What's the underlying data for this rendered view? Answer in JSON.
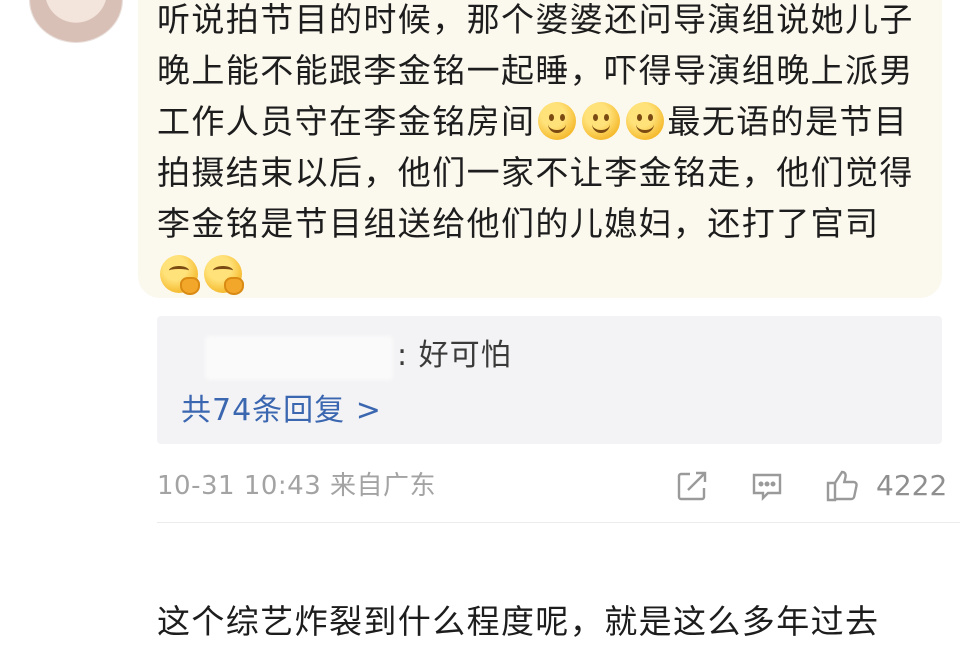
{
  "comment": {
    "segments": [
      "听说拍节目的时候，那个婆婆还问导演组说她儿子晚上能不能跟李金铭一起睡，吓得导演组晚上派男工作人员守在李金铭房间",
      "最无语的是节目拍摄结束以后，他们一家不让李金铭走，他们觉得李金铭是节目组送给他们的儿媳妇，还打了官司"
    ],
    "emojis_after_segment_1": [
      "smile",
      "smile",
      "smile"
    ],
    "emojis_after_segment_2": [
      "thinking",
      "thinking"
    ]
  },
  "reply_preview": {
    "text": ": 好可怕",
    "more_link": "共74条回复 >"
  },
  "meta": {
    "time_location": "10-31 10:43 来自广东"
  },
  "actions": {
    "share_icon": "share-icon",
    "comment_icon": "comment-icon",
    "like_icon": "thumbs-up-icon",
    "like_count": "4222"
  },
  "next_comment": {
    "text": "这个综艺炸裂到什么程度呢，就是这么多年过去"
  },
  "colors": {
    "bubble_bg": "#fbf8ee",
    "reply_bg": "#f3f3f5",
    "link": "#3b66b0",
    "meta": "#a3a3a3"
  }
}
